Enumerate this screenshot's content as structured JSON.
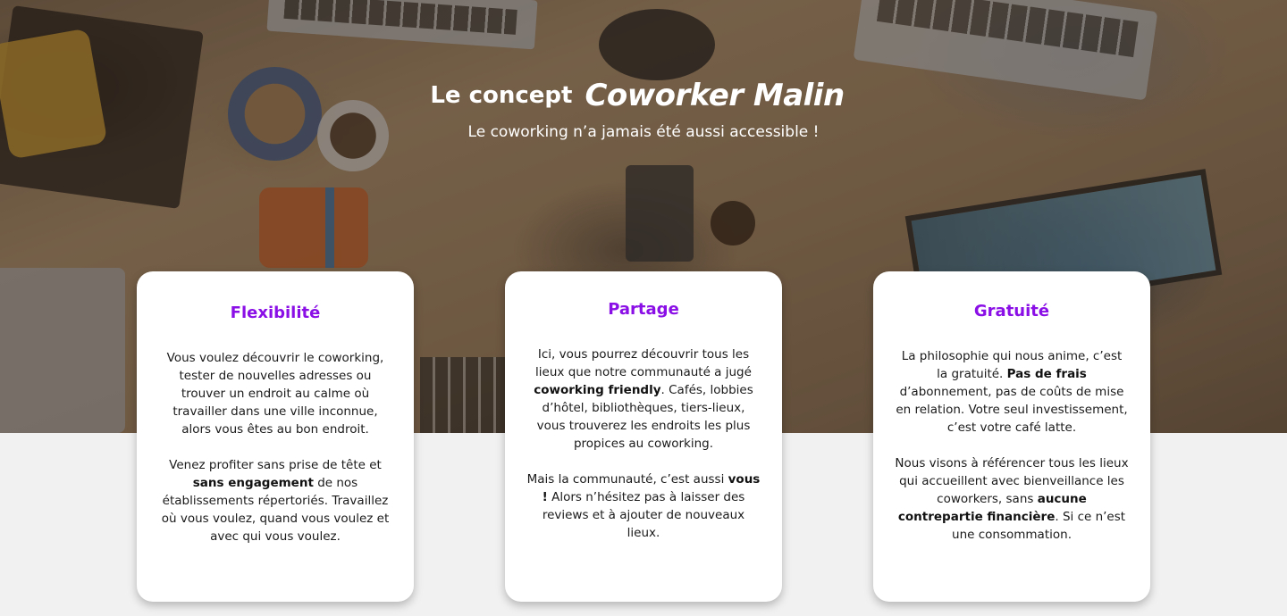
{
  "hero": {
    "title_lead": "Le concept",
    "title_brand": "Coworker Malin",
    "subtitle": "Le coworking n’a jamais été aussi accessible !"
  },
  "cards": [
    {
      "title": "Flexibilité",
      "p1": {
        "text": "Vous voulez découvrir le coworking, tester de nouvelles adresses ou trouver un endroit au calme où travailler dans une ville inconnue, alors vous êtes au bon endroit."
      },
      "p2": {
        "before": "Venez profiter sans prise de tête et ",
        "bold": "sans engagement",
        "after": " de nos établissements répertoriés. Travaillez où vous voulez, quand vous voulez et avec qui vous voulez."
      }
    },
    {
      "title": "Partage",
      "p1": {
        "before": "Ici, vous pourrez découvrir tous les lieux que notre communauté a jugé ",
        "bold": "coworking friendly",
        "after": ". Cafés, lobbies d’hôtel, bibliothèques, tiers-lieux, vous trouverez les endroits les plus propices au coworking."
      },
      "p2": {
        "before": "Mais la communauté, c’est aussi ",
        "bold": "vous !",
        "after": " Alors n’hésitez pas à laisser des reviews et à ajouter de nouveaux lieux."
      }
    },
    {
      "title": "Gratuité",
      "p1": {
        "before": "La philosophie qui nous anime, c’est la gratuité. ",
        "bold": "Pas de frais",
        "after": " d’abonnement, pas de coûts de mise en relation. Votre seul investissement, c’est votre café latte."
      },
      "p2": {
        "before": "Nous visons à référencer tous les lieux qui accueillent avec bienveillance les coworkers, sans ",
        "bold": "aucune contrepartie financière",
        "after": ". Si ce n’est une consommation."
      }
    }
  ],
  "colors": {
    "accent": "#8a0ee6",
    "card_bg": "#ffffff",
    "page_bg": "#f1f1f1"
  }
}
